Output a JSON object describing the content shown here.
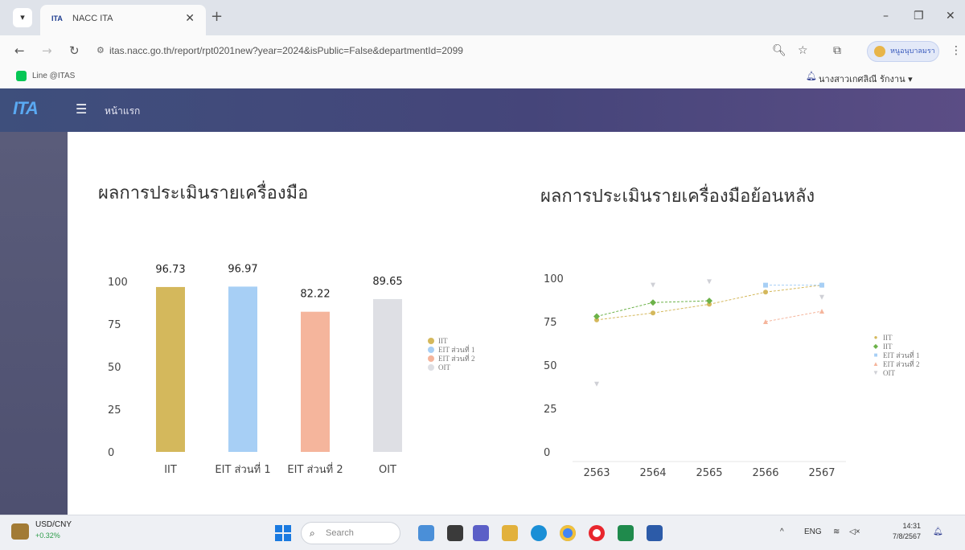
{
  "browser": {
    "tab_title": "NACC ITA",
    "favicon_text": "ITA",
    "url": "itas.nacc.go.th/report/rpt0201new?year=2024&isPublic=False&departmentId=2099",
    "profile_label": "หนูอนุบาลมรา"
  },
  "bookmarks": [
    {
      "label": "Line @ITAS"
    }
  ],
  "user": {
    "name": "นางสาวเกศลิณี รักงาน ▾"
  },
  "app": {
    "logo_text": "ITA",
    "nav_home": "หน้าแรก"
  },
  "left_section": {
    "title": "ผลการประเมินรายเครื่องมือ"
  },
  "right_section": {
    "title": "ผลการประเมินรายเครื่องมือย้อนหลัง"
  },
  "chart_data": [
    {
      "type": "bar",
      "categories": [
        "IIT",
        "EIT ส่วนที่ 1",
        "EIT ส่วนที่ 2",
        "OIT"
      ],
      "values": [
        96.73,
        96.97,
        82.22,
        89.65
      ],
      "data_labels": [
        "96.73",
        "96.97",
        "82.22",
        "89.65"
      ],
      "colors": [
        "#d4b85c",
        "#a7cff5",
        "#f5b59c",
        "#dedfe4"
      ],
      "ylim": [
        0,
        100
      ],
      "yticks": [
        "0",
        "25",
        "50",
        "75",
        "100"
      ],
      "legend": [
        "IIT",
        "EIT ส่วนที่ 1",
        "EIT ส่วนที่ 2",
        "OIT"
      ],
      "legend_position": "right",
      "grid": false
    },
    {
      "type": "line",
      "x": [
        "2563",
        "2564",
        "2565",
        "2566",
        "2567"
      ],
      "ylim": [
        0,
        100
      ],
      "yticks": [
        "0",
        "25",
        "50",
        "75",
        "100"
      ],
      "series": [
        {
          "name": "IIT",
          "color": "#d4b85c",
          "values": [
            76,
            80,
            85,
            92,
            96
          ]
        },
        {
          "name": "IIT",
          "color": "#6cb249",
          "values": [
            78,
            86,
            87,
            null,
            null
          ]
        },
        {
          "name": "EIT ส่วนที่ 1",
          "color": "#a7cff5",
          "values": [
            null,
            null,
            null,
            96,
            96
          ]
        },
        {
          "name": "EIT ส่วนที่ 2",
          "color": "#f5b59c",
          "values": [
            null,
            null,
            null,
            75,
            81
          ]
        },
        {
          "name": "OIT",
          "color": "#cfd0d6",
          "values": [
            39,
            96,
            98,
            null,
            89
          ]
        }
      ],
      "legend_position": "right",
      "grid": false
    }
  ],
  "taskbar": {
    "widget_name": "USD/CNY",
    "widget_change": "+0.32%",
    "search_placeholder": "Search",
    "lang": "ENG",
    "time": "14:31",
    "date": "7/8/2567"
  }
}
